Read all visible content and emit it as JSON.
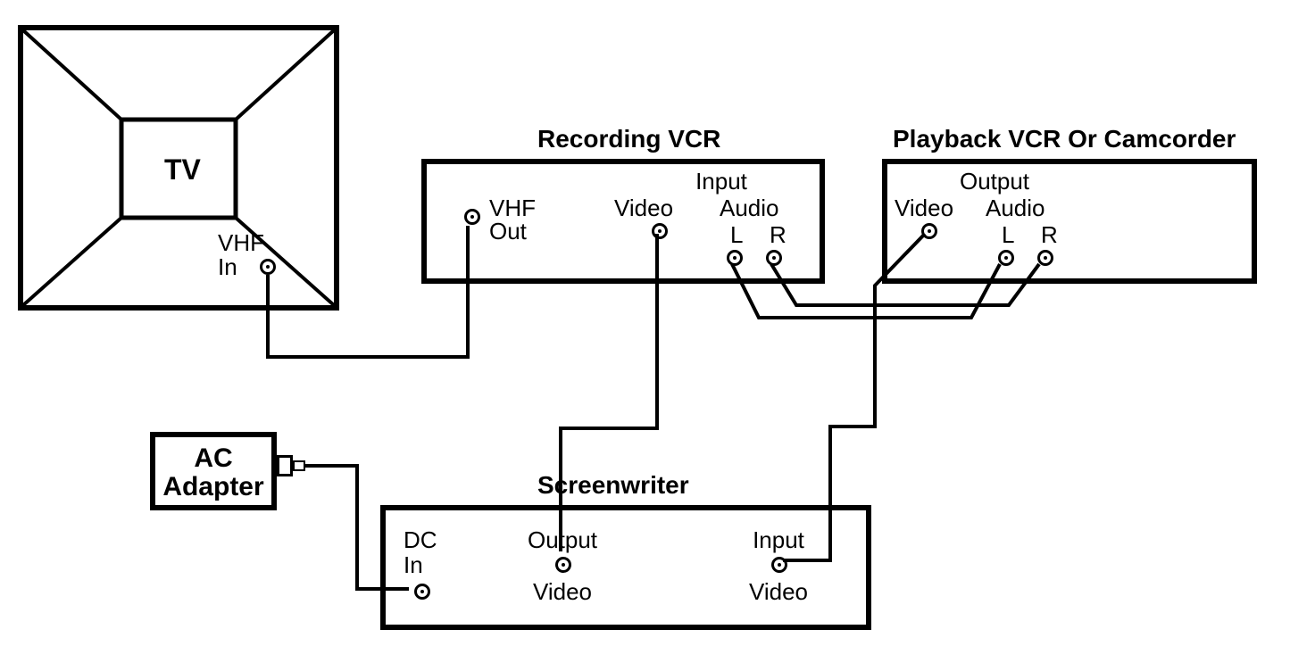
{
  "tv": {
    "label": "TV",
    "port": {
      "line1": "VHF",
      "line2": "In"
    }
  },
  "recording_vcr": {
    "title": "Recording VCR",
    "vhf_out": {
      "line1": "VHF",
      "line2": "Out"
    },
    "input_group": "Input",
    "video": "Video",
    "audio": "Audio",
    "l": "L",
    "r": "R"
  },
  "playback_vcr": {
    "title": "Playback VCR Or Camcorder",
    "output_group": "Output",
    "video": "Video",
    "audio": "Audio",
    "l": "L",
    "r": "R"
  },
  "ac_adapter": {
    "line1": "AC",
    "line2": "Adapter"
  },
  "screenwriter": {
    "title": "Screenwriter",
    "dc_in": {
      "line1": "DC",
      "line2": "In"
    },
    "output": "Output",
    "input": "Input",
    "video": "Video"
  }
}
